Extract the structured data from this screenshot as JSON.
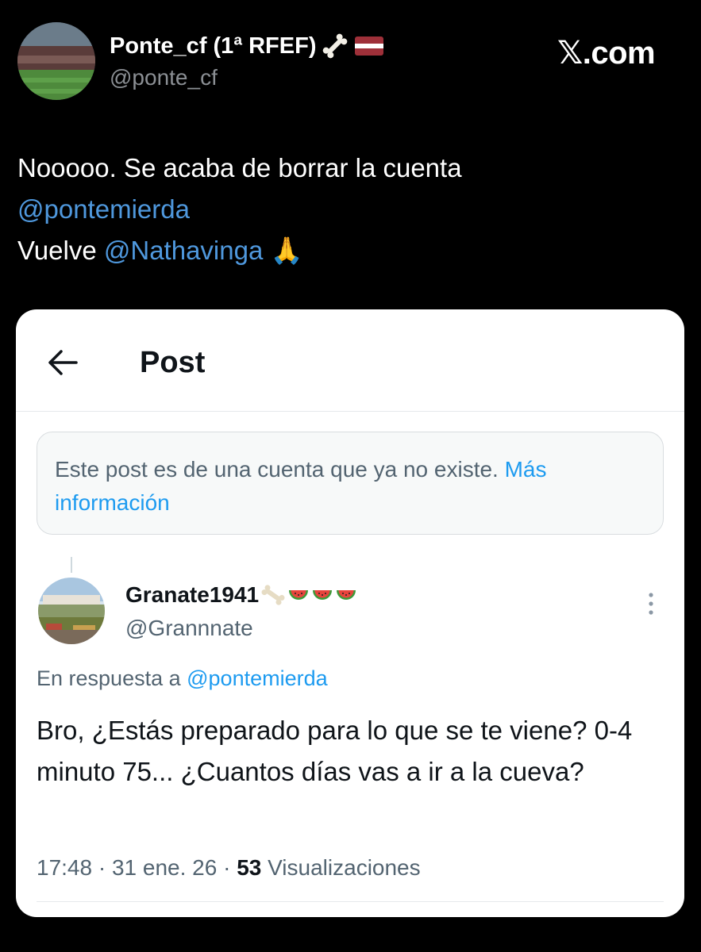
{
  "outer": {
    "display_name": "Ponte_cf (1ª RFEF)",
    "handle": "@ponte_cf",
    "badges": [
      "bone-icon",
      "latvian-flag-icon"
    ],
    "brand": {
      "x_glyph": "𝕏",
      "suffix": ".com"
    },
    "tweet": {
      "line1": "Nooooo. Se acaba de borrar la cuenta",
      "mention1": "@pontemierda",
      "line3_prefix": "Vuelve ",
      "mention2": "@Nathavinga",
      "emoji": "🙏"
    }
  },
  "card": {
    "back_icon": "back-arrow-icon",
    "title": "Post",
    "notice": {
      "text": "Este post es de una cuenta que ya no existe. ",
      "link": "Más información"
    },
    "reply": {
      "display_name": "Granate1941",
      "name_emojis": [
        "bone-icon",
        "watermelon-icon",
        "watermelon-icon",
        "watermelon-icon"
      ],
      "handle": "@Grannnate",
      "in_reply_prefix": "En respuesta a ",
      "in_reply_mention": "@pontemierda",
      "text": "Bro, ¿Estás preparado para lo que se te viene? 0-4 minuto 75... ¿Cuantos días vas a ir a la cueva?",
      "time": "17:48",
      "date": "31 ene. 26",
      "views_count": "53",
      "views_label": "Visualizaciones"
    }
  },
  "colors": {
    "background": "#000000",
    "link_dark": "#4f98dd",
    "link_light": "#1d9bf0",
    "muted": "#536471"
  }
}
